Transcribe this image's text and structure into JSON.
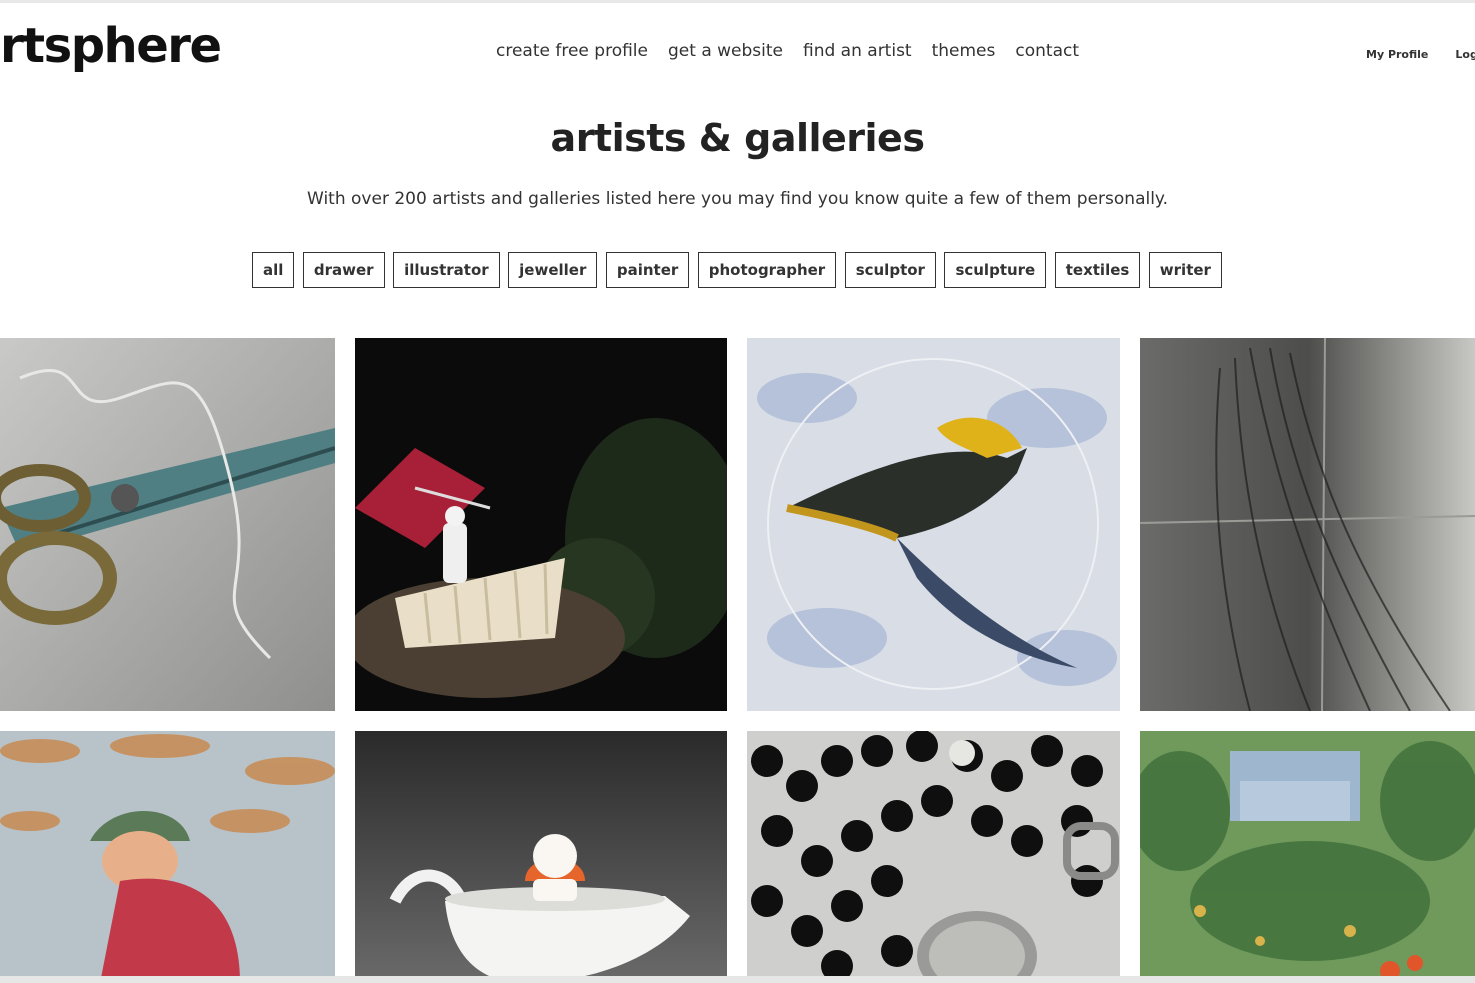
{
  "site": {
    "logo": "rtsphere"
  },
  "nav": {
    "items": [
      "create free profile",
      "get a website",
      "find an artist",
      "themes",
      "contact"
    ]
  },
  "account": {
    "profile_label": "My Profile",
    "login_label": "Log"
  },
  "page": {
    "title": "artists & galleries",
    "subtitle": "With over 200 artists and galleries listed here you may find you know quite a few of them personally."
  },
  "filters": [
    "all",
    "drawer",
    "illustrator",
    "jeweller",
    "painter",
    "photographer",
    "sculptor",
    "sculpture",
    "textiles",
    "writer"
  ],
  "gallery": {
    "tiles": [
      {
        "name": "scissors-painting"
      },
      {
        "name": "figure-on-boat-photo"
      },
      {
        "name": "bird-painting"
      },
      {
        "name": "charcoal-hair-drawing"
      },
      {
        "name": "child-in-cap-painting"
      },
      {
        "name": "porcelain-gravy-boat-sculpture"
      },
      {
        "name": "black-bead-necklace-jewellery"
      },
      {
        "name": "garden-impressionist-painting"
      }
    ]
  },
  "colors": {
    "text": "#1c1c1c",
    "border": "#333333",
    "background": "#ffffff"
  }
}
